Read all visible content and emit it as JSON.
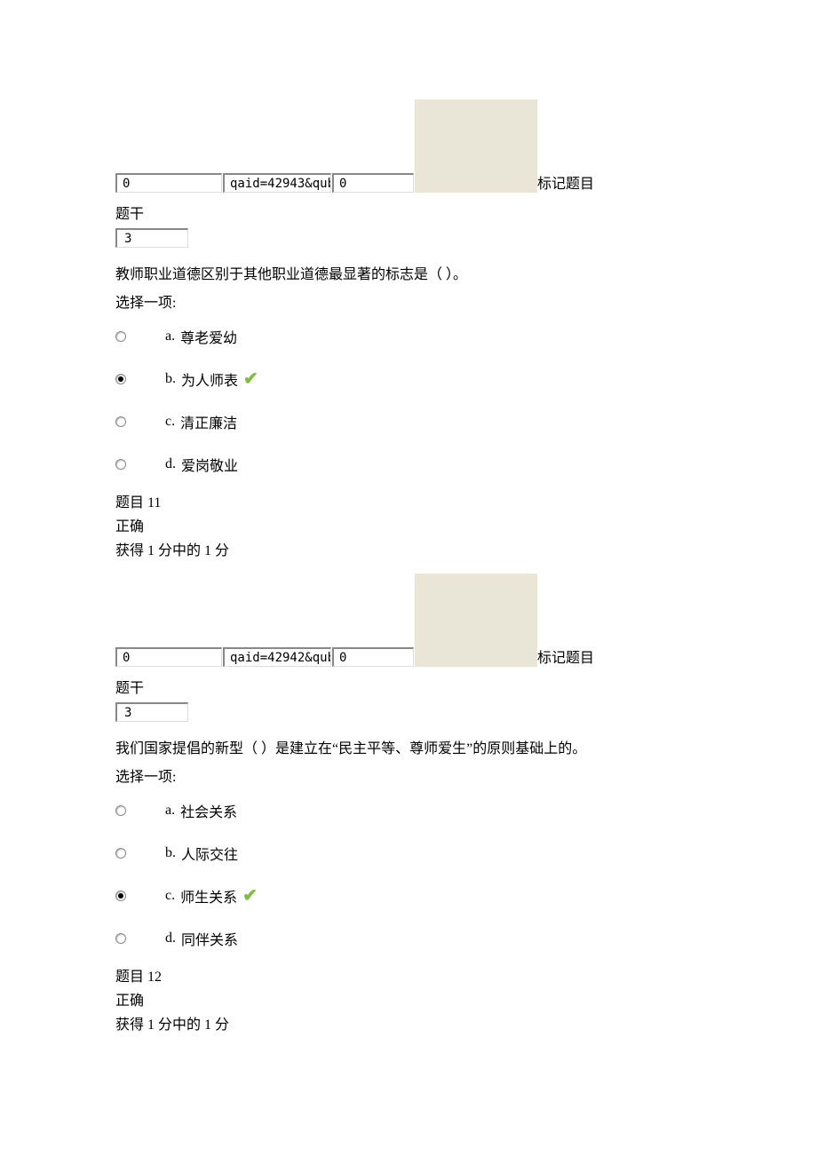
{
  "q1": {
    "flag": {
      "box_a": "0",
      "box_b": "qaid=42943&qub",
      "box_c": "0",
      "label": "标记题目"
    },
    "stem_label": "题干",
    "num_box": "3",
    "question": "教师职业道德区别于其他职业道德最显著的标志是（ ）。",
    "choose": "选择一项:",
    "options": {
      "a": {
        "letter": "a.",
        "text": "尊老爱幼"
      },
      "b": {
        "letter": "b.",
        "text": "为人师表"
      },
      "c": {
        "letter": "c.",
        "text": "清正廉洁"
      },
      "d": {
        "letter": "d.",
        "text": "爱岗敬业"
      }
    },
    "summary": {
      "title": "题目 11",
      "status": "正确",
      "score": "获得 1 分中的 1 分"
    }
  },
  "q2": {
    "flag": {
      "box_a": "0",
      "box_b": "qaid=42942&qub",
      "box_c": "0",
      "label": "标记题目"
    },
    "stem_label": "题干",
    "num_box": "3",
    "question": "我们国家提倡的新型（ ）是建立在“民主平等、尊师爱生”的原则基础上的。",
    "choose": "选择一项:",
    "options": {
      "a": {
        "letter": "a.",
        "text": "社会关系"
      },
      "b": {
        "letter": "b.",
        "text": "人际交往"
      },
      "c": {
        "letter": "c.",
        "text": "师生关系"
      },
      "d": {
        "letter": "d.",
        "text": "同伴关系"
      }
    },
    "summary": {
      "title": "题目 12",
      "status": "正确",
      "score": "获得 1 分中的 1 分"
    }
  }
}
